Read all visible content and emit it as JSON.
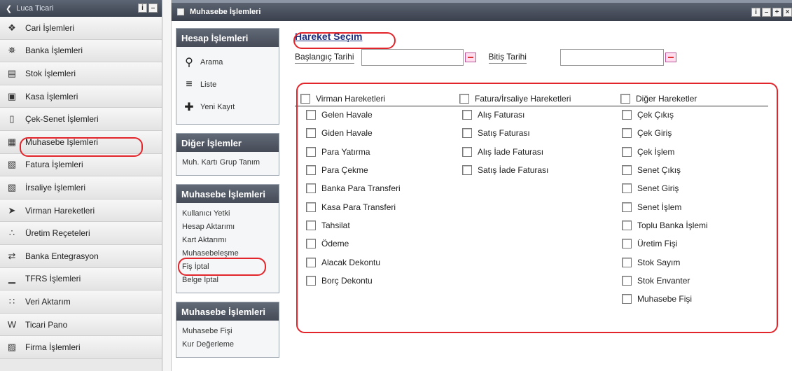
{
  "sidebar": {
    "header_title": "Luca Ticari",
    "items": [
      {
        "label": "Cari İşlemleri",
        "icon": "handshake-icon"
      },
      {
        "label": "Banka İşlemleri",
        "icon": "bank-icon"
      },
      {
        "label": "Stok İşlemleri",
        "icon": "clipboard-icon"
      },
      {
        "label": "Kasa İşlemleri",
        "icon": "cash-register-icon"
      },
      {
        "label": "Çek-Senet İşlemleri",
        "icon": "cheque-icon"
      },
      {
        "label": "Muhasebe İşlemleri",
        "icon": "calculator-icon"
      },
      {
        "label": "Fatura İşlemleri",
        "icon": "invoice-icon"
      },
      {
        "label": "İrsaliye İşlemleri",
        "icon": "waybill-icon"
      },
      {
        "label": "Virman Hareketleri",
        "icon": "transfer-icon"
      },
      {
        "label": "Üretim Reçeteleri",
        "icon": "production-icon"
      },
      {
        "label": "Banka Entegrasyon",
        "icon": "integration-icon"
      },
      {
        "label": "TFRS İşlemleri",
        "icon": "chart-icon"
      },
      {
        "label": "Veri Aktarım",
        "icon": "data-transfer-icon"
      },
      {
        "label": "Ticari Pano",
        "icon": "dashboard-icon"
      },
      {
        "label": "Firma İşlemleri",
        "icon": "company-icon"
      }
    ]
  },
  "window": {
    "title": "Muhasebe İşlemleri"
  },
  "panel": {
    "hesap": {
      "title": "Hesap İşlemleri",
      "items": [
        {
          "label": "Arama",
          "icon": "search-icon"
        },
        {
          "label": "Liste",
          "icon": "list-icon"
        },
        {
          "label": "Yeni Kayıt",
          "icon": "plus-icon"
        }
      ]
    },
    "diger": {
      "title": "Diğer İşlemler",
      "items": [
        "Muh. Kartı Grup Tanım"
      ]
    },
    "muhasebe1": {
      "title": "Muhasebe İşlemleri",
      "items": [
        "Kullanıcı Yetki",
        "Hesap Aktarımı",
        "Kart Aktarımı",
        "Muhasebeleşme",
        "Fiş İptal",
        "Belge İptal"
      ]
    },
    "muhasebe2": {
      "title": "Muhasebe İşlemleri",
      "items": [
        "Muhasebe Fişi",
        "Kur Değerleme"
      ]
    }
  },
  "form": {
    "title": "Hareket Seçim",
    "start_label": "Başlangıç Tarihi",
    "end_label": "Bitiş Tarihi",
    "start_value": "",
    "end_value": "",
    "col1": {
      "header": "Virman Hareketleri",
      "items": [
        "Gelen Havale",
        "Giden Havale",
        "Para Yatırma",
        "Para Çekme",
        "Banka Para Transferi",
        "Kasa Para Transferi",
        "Tahsilat",
        "Ödeme",
        "Alacak Dekontu",
        "Borç Dekontu"
      ]
    },
    "col2": {
      "header": "Fatura/İrsaliye Hareketleri",
      "items": [
        "Alış Faturası",
        "Satış Faturası",
        "Alış İade Faturası",
        "Satış İade Faturası"
      ]
    },
    "col3": {
      "header": "Diğer Hareketler",
      "items": [
        "Çek Çıkış",
        "Çek Giriş",
        "Çek İşlem",
        "Senet Çıkış",
        "Senet Giriş",
        "Senet İşlem",
        "Toplu Banka İşlemi",
        "Üretim Fişi",
        "Stok Sayım",
        "Stok Envanter",
        "Muhasebe Fişi"
      ]
    }
  },
  "colors": {
    "annotation": "#e2252b",
    "title_blue": "#1d2f80",
    "header_dark": "#454b57"
  }
}
